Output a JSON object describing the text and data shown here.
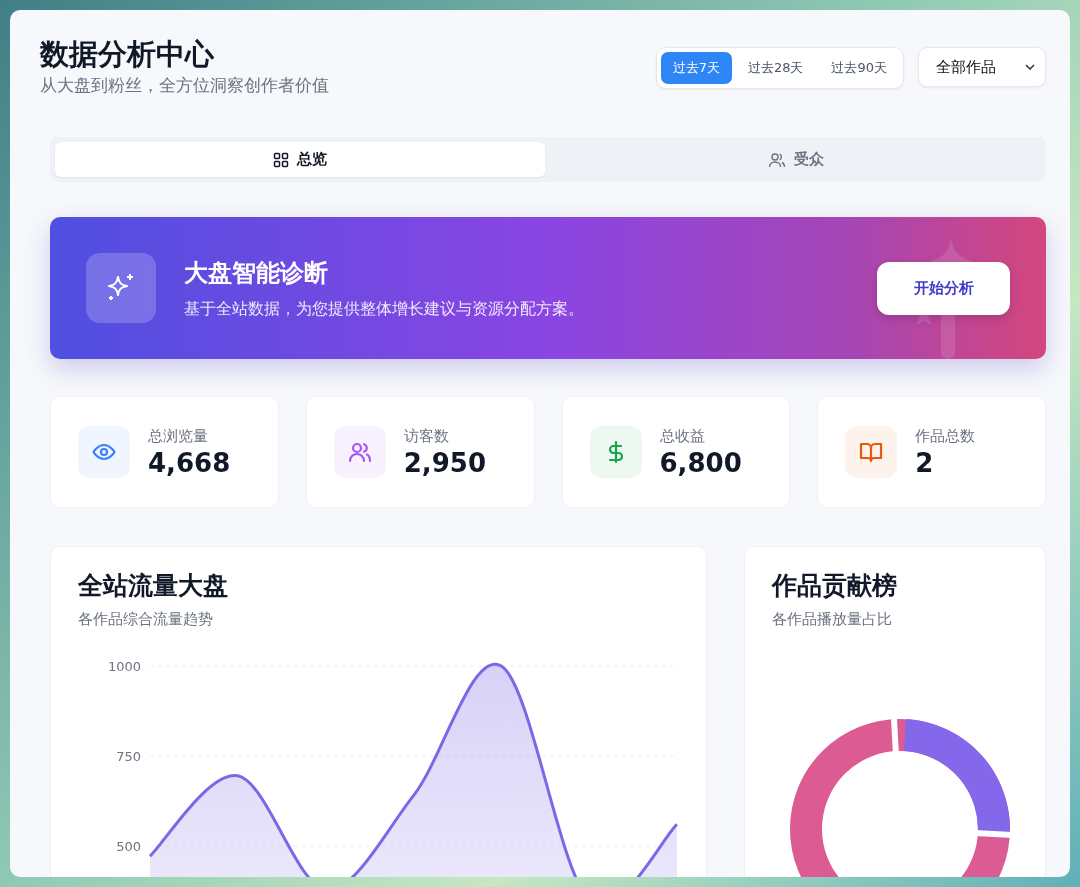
{
  "header": {
    "title": "数据分析中心",
    "subtitle": "从大盘到粉丝，全方位洞察创作者价值"
  },
  "range_options": [
    {
      "label": "过去7天",
      "selected": true
    },
    {
      "label": "过去28天",
      "selected": false
    },
    {
      "label": "过去90天",
      "selected": false
    }
  ],
  "works_filter": {
    "value": "全部作品"
  },
  "tabs": [
    {
      "label": "总览",
      "selected": true
    },
    {
      "label": "受众",
      "selected": false
    }
  ],
  "banner": {
    "title": "大盘智能诊断",
    "description": "基于全站数据，为您提供整体增长建议与资源分配方案。",
    "button": "开始分析"
  },
  "stats": [
    {
      "label": "总浏览量",
      "value": "4,668",
      "color": "#3b82f6"
    },
    {
      "label": "访客数",
      "value": "2,950",
      "color": "#a855f7"
    },
    {
      "label": "总收益",
      "value": "6,800",
      "color": "#16a34a"
    },
    {
      "label": "作品总数",
      "value": "2",
      "color": "#ea580c"
    }
  ],
  "traffic_panel": {
    "title": "全站流量大盘",
    "subtitle": "各作品综合流量趋势",
    "y_axis_labels": [
      "1000",
      "750",
      "500"
    ]
  },
  "ranking_panel": {
    "title": "作品贡献榜",
    "subtitle": "各作品播放量占比"
  }
}
